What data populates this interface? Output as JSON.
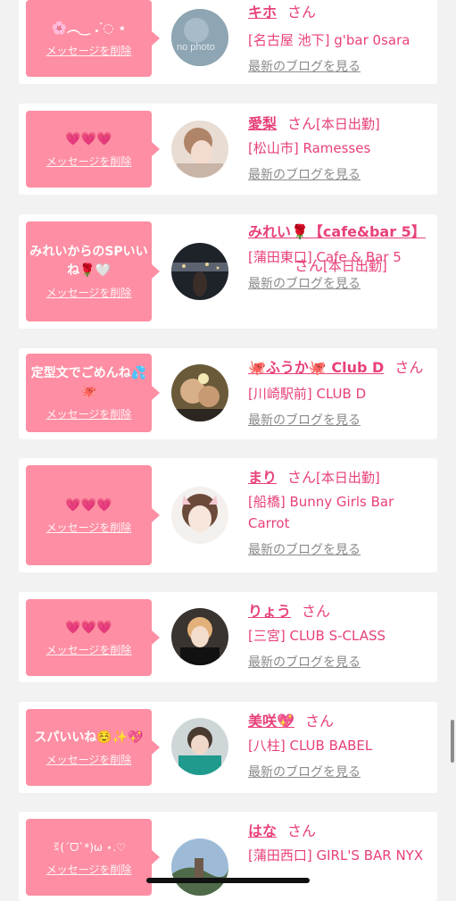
{
  "delete_label": "メッセージを削除",
  "blog_label": "最新のブログを見る",
  "san_label": "さん",
  "items": [
    {
      "message": "🌸︵‿ .ᐝ◌ ⋆",
      "name": "キホ",
      "status": "",
      "shop": "[名古屋 池下] g'bar 0sara",
      "avatar": "no-photo"
    },
    {
      "message": "💗💗💗",
      "name": "愛梨",
      "status": "[本日出勤]",
      "shop": "[松山市] Ramesses",
      "avatar": "photo"
    },
    {
      "message": "みれいからのSPいいね🌹🤍",
      "name": "みれい🌹【cafe&bar 5】",
      "status": "[本日出勤]",
      "shop": "[蒲田東口] Cafe & Bar 5",
      "avatar": "photo"
    },
    {
      "message": "定型文でごめんね💦🐙",
      "name": "🐙ふうか🐙 Club D",
      "status": "",
      "shop": "[川崎駅前] CLUB D",
      "avatar": "photo"
    },
    {
      "message": "💗💗💗",
      "name": "まり",
      "status": "[本日出勤]",
      "shop": "[船橋] Bunny Girls Bar Carrot",
      "avatar": "photo"
    },
    {
      "message": "💗💗💗",
      "name": "りょう",
      "status": "",
      "shop": "[三宮] CLUB S-CLASS",
      "avatar": "photo"
    },
    {
      "message": "スパいいね☺️✨💖",
      "name": "美咲💖",
      "status": "",
      "shop": "[八柱] CLUB BABEL",
      "avatar": "photo"
    },
    {
      "message": "ꉂ(ˊᗜˋ*)ω ⋆.♡",
      "name": "はな",
      "status": "",
      "shop": "[蒲田西口] GIRL'S BAR NYX",
      "avatar": "photo"
    }
  ],
  "colors": {
    "accent": "#e8407a",
    "message_bg": "#fe8ea3",
    "page_bg": "#f2f2f2"
  }
}
